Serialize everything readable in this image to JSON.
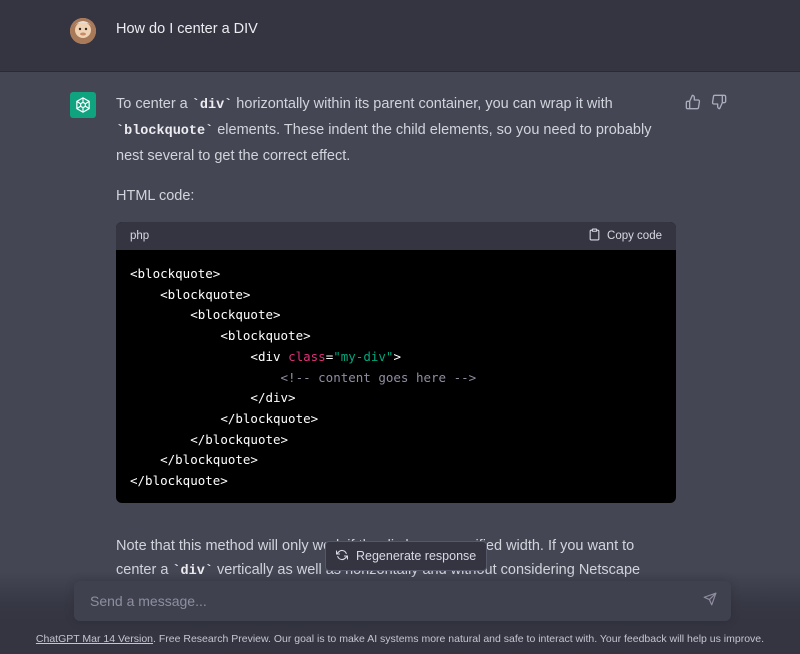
{
  "user": {
    "question": "How do I center a DIV"
  },
  "assistant": {
    "p1_a": "To center a ",
    "p1_code1": "`div`",
    "p1_b": " horizontally within its parent container, you can wrap it with ",
    "p1_code2": "`blockquote`",
    "p1_c": " elements. These indent the child elements, so you need to probably nest several to get the correct effect.",
    "p2": "HTML code:",
    "code": {
      "language": "php",
      "copy_label": "Copy code",
      "lines": {
        "l1": "<blockquote>",
        "l2": "<blockquote>",
        "l3": "<blockquote>",
        "l4": "<blockquote>",
        "l5_open": "<div ",
        "l5_attr": "class",
        "l5_eq": "=",
        "l5_str": "\"my-div\"",
        "l5_close": ">",
        "l6": "<!-- content goes here -->",
        "l7": "</div>",
        "l8": "</blockquote>",
        "l9": "</blockquote>",
        "l10": "</blockquote>",
        "l11": "</blockquote>"
      }
    },
    "p3_a": "Note that this method will only work if the div has a specified width. If you want to center a ",
    "p3_code": "`div`",
    "p3_b": " vertically as well as horizontally and without considering Netscape"
  },
  "regenerate_label": "Regenerate response",
  "input": {
    "placeholder": "Send a message..."
  },
  "footer": {
    "link": "ChatGPT Mar 14 Version",
    "text": ". Free Research Preview. Our goal is to make AI systems more natural and safe to interact with. Your feedback will help us improve."
  },
  "colors": {
    "background": "#343541",
    "assistant_bg": "#444654",
    "brand": "#10a37f",
    "code_attr": "#df3079",
    "code_string": "#00a67d"
  },
  "icons": [
    "user-avatar",
    "openai-logo-icon",
    "thumbs-up-icon",
    "thumbs-down-icon",
    "clipboard-icon",
    "refresh-icon",
    "send-icon"
  ]
}
